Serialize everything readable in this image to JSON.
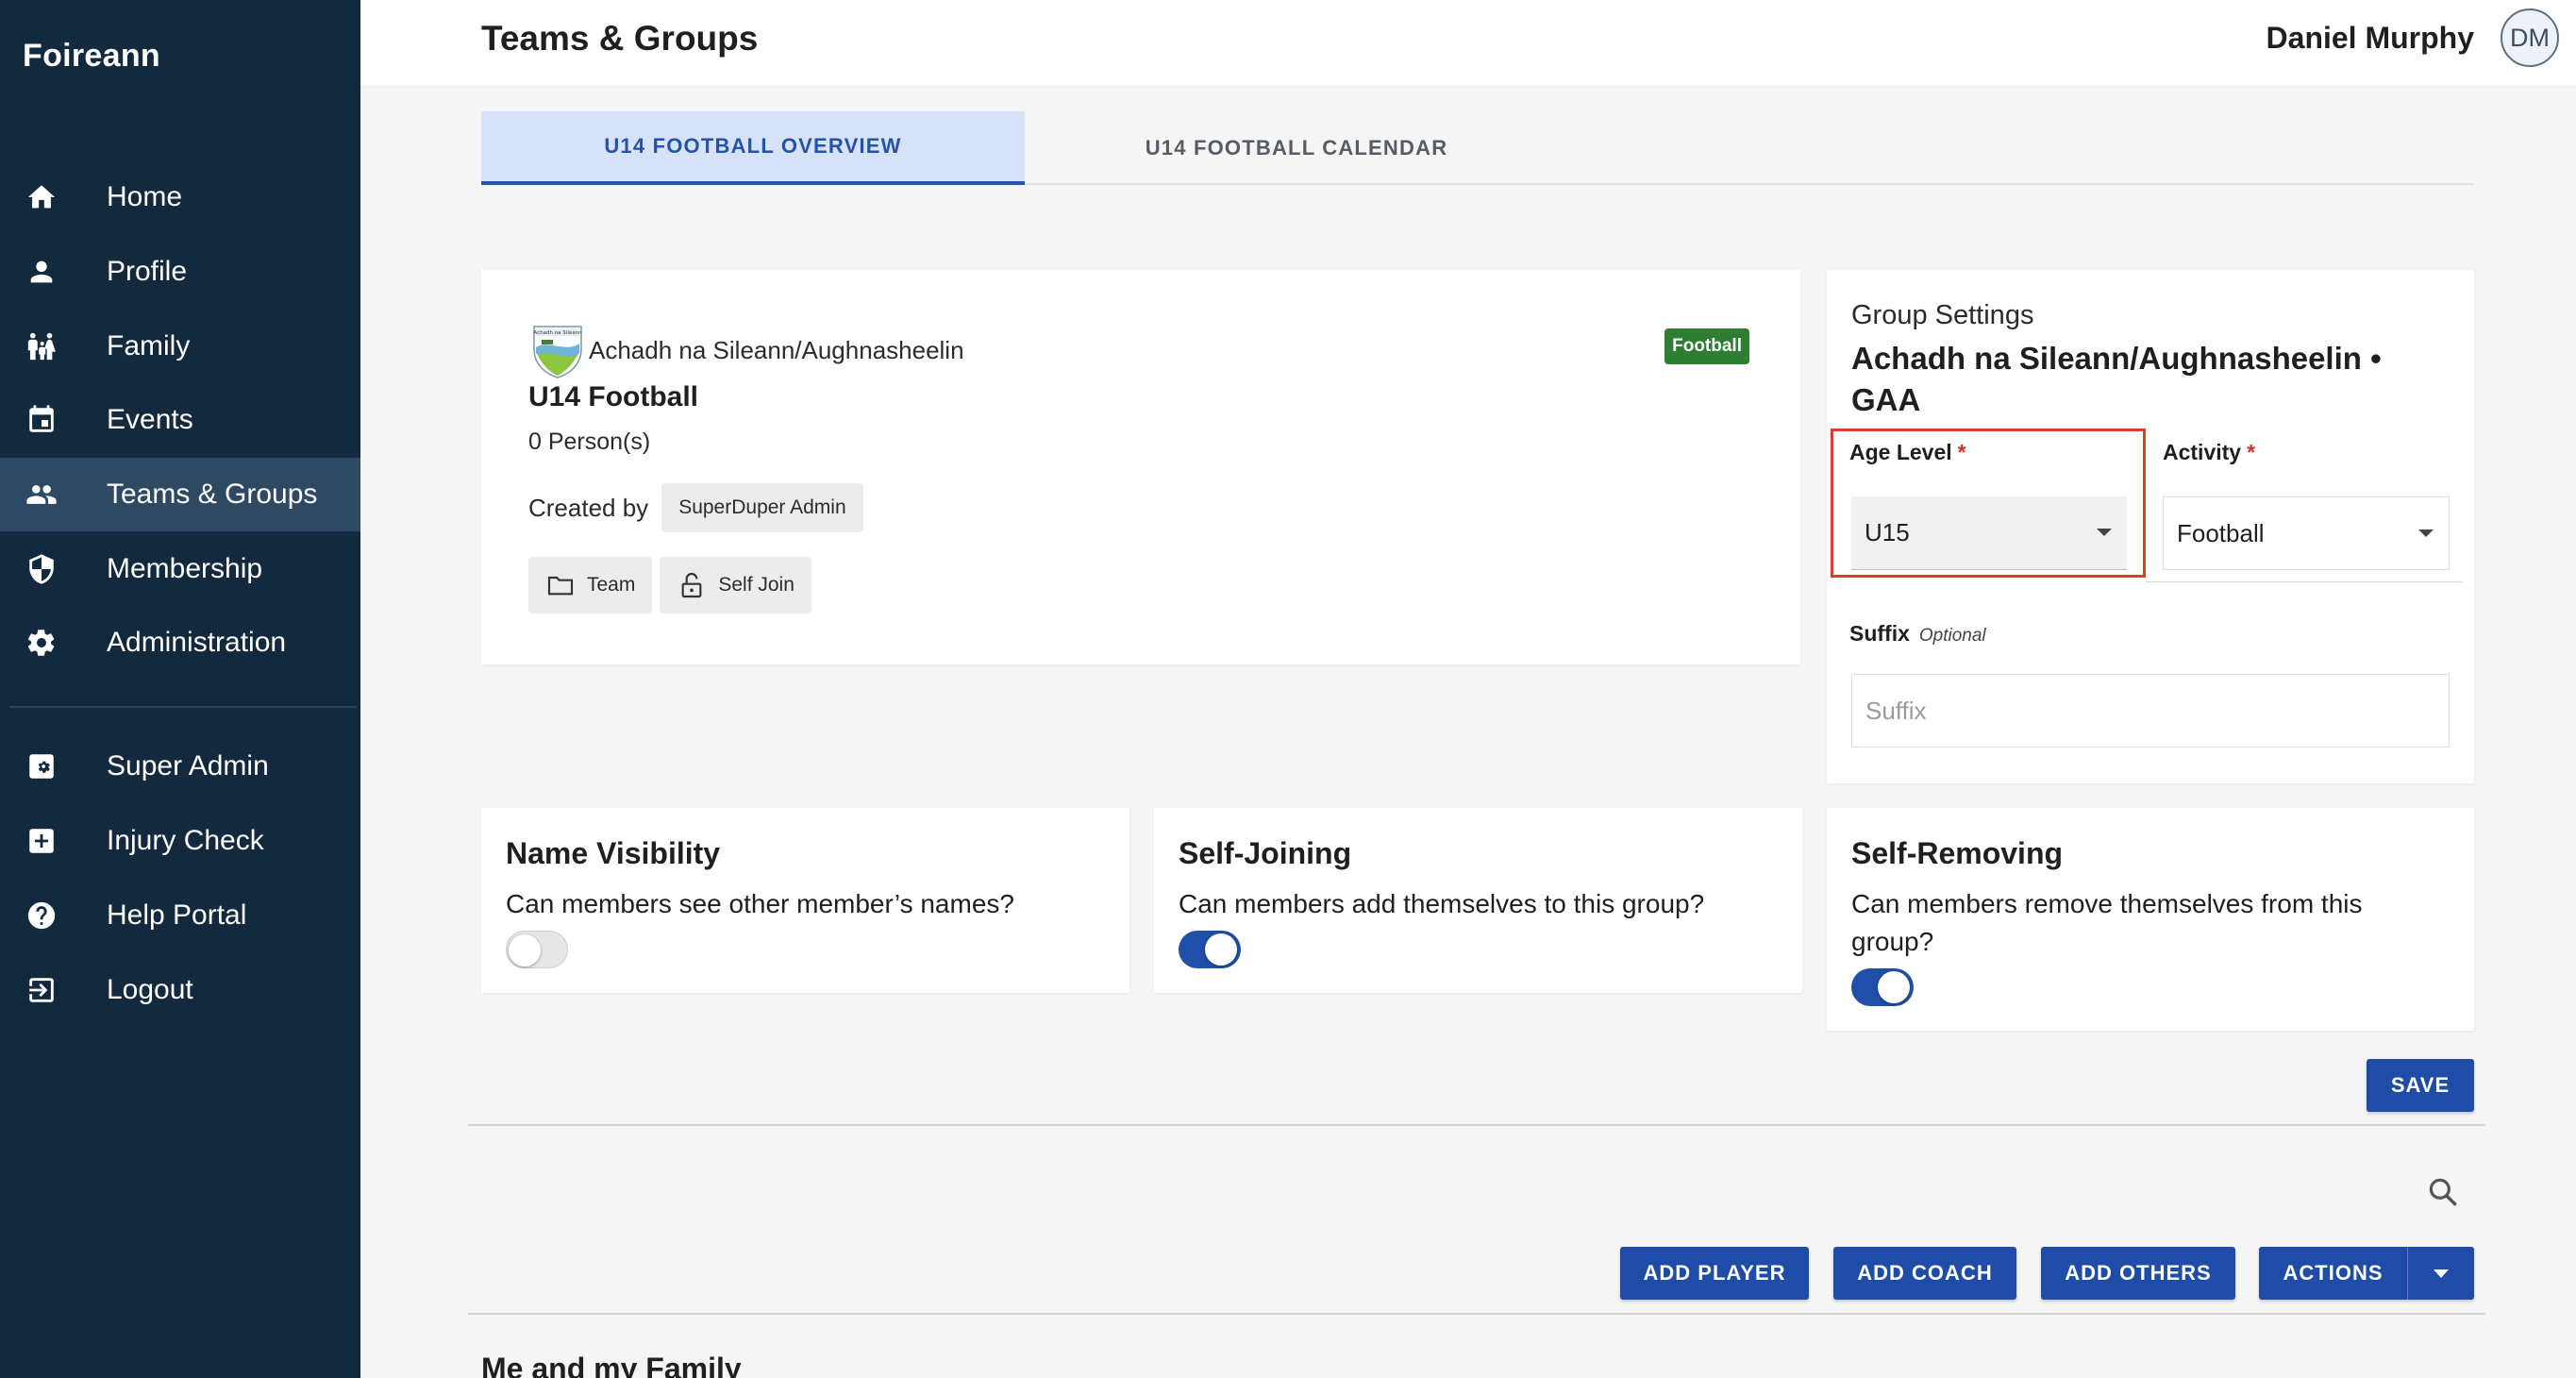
{
  "app": {
    "brand": "Foireann"
  },
  "sidebar": {
    "items": [
      {
        "label": "Home",
        "icon": "home-icon"
      },
      {
        "label": "Profile",
        "icon": "person-icon"
      },
      {
        "label": "Family",
        "icon": "family-icon"
      },
      {
        "label": "Events",
        "icon": "calendar-icon"
      },
      {
        "label": "Teams & Groups",
        "icon": "group-icon",
        "active": true
      },
      {
        "label": "Membership",
        "icon": "shield-icon"
      },
      {
        "label": "Administration",
        "icon": "gear-icon"
      }
    ],
    "secondary_items": [
      {
        "label": "Super Admin",
        "icon": "admin-settings-icon"
      },
      {
        "label": "Injury Check",
        "icon": "medical-plus-icon"
      },
      {
        "label": "Help Portal",
        "icon": "help-icon"
      },
      {
        "label": "Logout",
        "icon": "logout-icon"
      }
    ]
  },
  "header": {
    "title": "Teams & Groups",
    "user_name": "Daniel Murphy",
    "avatar_initials": "DM"
  },
  "tabs": [
    {
      "label": "U14 FOOTBALL OVERVIEW",
      "active": true
    },
    {
      "label": "U14 FOOTBALL CALENDAR",
      "active": false
    }
  ],
  "overview": {
    "club_crest_text": "Achadh na Sileann",
    "club_name": "Achadh na Sileann/Aughnasheelin",
    "sport_badge": "Football",
    "group_name": "U14 Football",
    "persons": "0 Person(s)",
    "created_by_label": "Created by",
    "created_by": "SuperDuper Admin",
    "chips": [
      {
        "label": "Team",
        "icon": "folder-icon"
      },
      {
        "label": "Self Join",
        "icon": "unlock-icon"
      }
    ]
  },
  "group_settings": {
    "title": "Group Settings",
    "subtitle": "Achadh na Sileann/Aughnasheelin • GAA",
    "age_level_label": "Age Level",
    "age_level_value": "U15",
    "activity_label": "Activity",
    "activity_value": "Football",
    "required_mark": "*",
    "suffix_label": "Suffix",
    "suffix_optional": "Optional",
    "suffix_placeholder": "Suffix"
  },
  "toggles": [
    {
      "title": "Name Visibility",
      "description": "Can members see other member’s names?",
      "enabled": false
    },
    {
      "title": "Self-Joining",
      "description": "Can members add themselves to this group?",
      "enabled": true
    },
    {
      "title": "Self-Removing",
      "description": "Can members remove themselves from this group?",
      "enabled": true
    }
  ],
  "actions": {
    "save": "SAVE",
    "add_player": "ADD PLAYER",
    "add_coach": "ADD COACH",
    "add_others": "ADD OTHERS",
    "actions": "ACTIONS"
  },
  "sections": {
    "family_title": "Me and my Family"
  },
  "colors": {
    "sidebar_bg": "#13293d",
    "sidebar_active": "#2e4a62",
    "primary": "#1e4ca6",
    "tab_active_bg": "#d6e2f7",
    "badge_green": "#2e7d32",
    "highlight": "#d8402c"
  }
}
